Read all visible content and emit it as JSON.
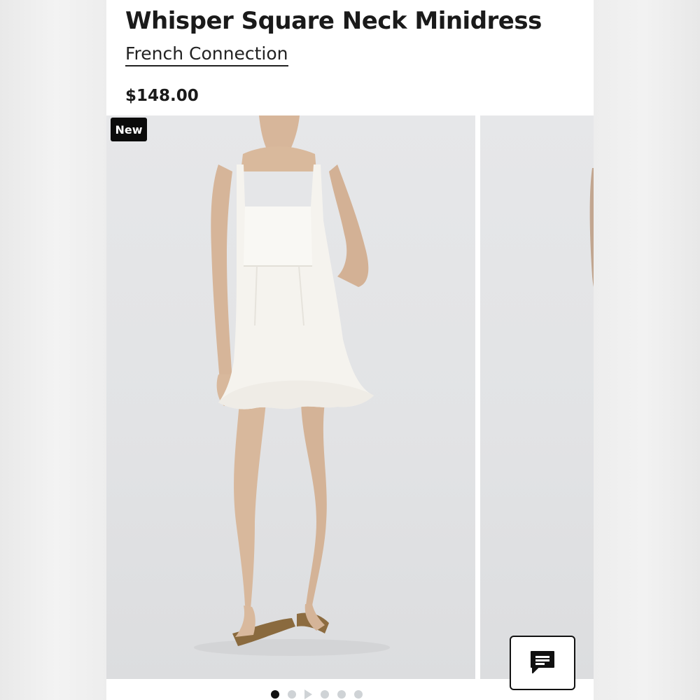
{
  "product": {
    "title": "Whisper Square Neck Minidress",
    "brand": "French Connection",
    "price": "$148.00"
  },
  "gallery": {
    "badge": "New",
    "slide_count": 6,
    "active_slide": 1,
    "icons": {
      "feedback": "chat-icon",
      "video": "play-icon"
    }
  },
  "colors": {
    "text": "#1a1a1a",
    "badge_bg": "#0b0b0b",
    "dot_active": "#111111",
    "dot_inactive": "#cfd3d6"
  }
}
